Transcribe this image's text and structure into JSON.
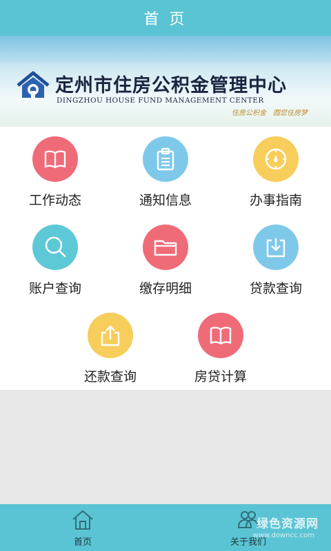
{
  "header": {
    "title": "首 页"
  },
  "banner": {
    "title_cn": "定州市住房公积金管理中心",
    "title_en": "DINGZHOU HOUSE FUND MANAGEMENT CENTER",
    "slogan": "住房公积金　圆您住房梦"
  },
  "menu": [
    {
      "label": "工作动态",
      "icon": "book-icon",
      "color": "#f06b78"
    },
    {
      "label": "通知信息",
      "icon": "clipboard-icon",
      "color": "#7ec9ea"
    },
    {
      "label": "办事指南",
      "icon": "compass-icon",
      "color": "#f7cd5b"
    },
    {
      "label": "账户查询",
      "icon": "search-icon",
      "color": "#5dc8d6"
    },
    {
      "label": "缴存明细",
      "icon": "folder-icon",
      "color": "#f06b78"
    },
    {
      "label": "贷款查询",
      "icon": "download-icon",
      "color": "#7ec9ea"
    },
    {
      "label": "还款查询",
      "icon": "upload-icon",
      "color": "#f7cd5b"
    },
    {
      "label": "房贷计算",
      "icon": "book-icon",
      "color": "#f06b78"
    }
  ],
  "tabbar": {
    "home_label": "首页",
    "home_icon": "home-icon",
    "about_label": "关于我们",
    "about_icon": "user-group-icon"
  },
  "watermark": {
    "text": "绿色资源网",
    "url": "www.downcc.com"
  }
}
